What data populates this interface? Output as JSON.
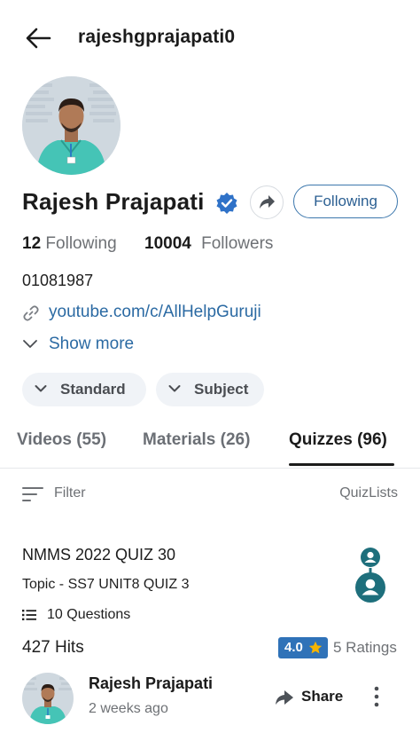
{
  "header": {
    "username": "rajeshgprajapati0",
    "back_icon": "arrow-left-icon"
  },
  "profile": {
    "name": "Rajesh Prajapati",
    "verified_icon": "verified-badge-icon",
    "following_button": "Following",
    "following_count": "12",
    "following_label": "Following",
    "followers_count": "10004",
    "followers_label": "Followers",
    "bio": "01081987",
    "link": "youtube.com/c/AllHelpGuruji",
    "show_more": "Show more"
  },
  "filters": {
    "chips": [
      "Standard",
      "Subject"
    ]
  },
  "tabs": [
    {
      "label": "Videos (55)",
      "active": false
    },
    {
      "label": "Materials (26)",
      "active": false
    },
    {
      "label": "Quizzes (96)",
      "active": true
    }
  ],
  "toolbar": {
    "filter_label": "Filter",
    "quizlists_label": "QuizLists"
  },
  "quiz_card": {
    "title": "NMMS 2022 QUIZ 30",
    "topic": "Topic - SS7 UNIT8  QUIZ 3",
    "questions": "10 Questions",
    "hits": "427 Hits",
    "rating": "4.0",
    "ratings_count": "5 Ratings",
    "author_name": "Rajesh Prajapati",
    "posted": "2 weeks ago",
    "share_label": "Share"
  },
  "colors": {
    "accent": "#2b6aa3",
    "rating_badge": "#2f72b8",
    "verified": "#2f72c8",
    "quiz_graphic": "#1e6f7c",
    "star": "#f5b400"
  }
}
